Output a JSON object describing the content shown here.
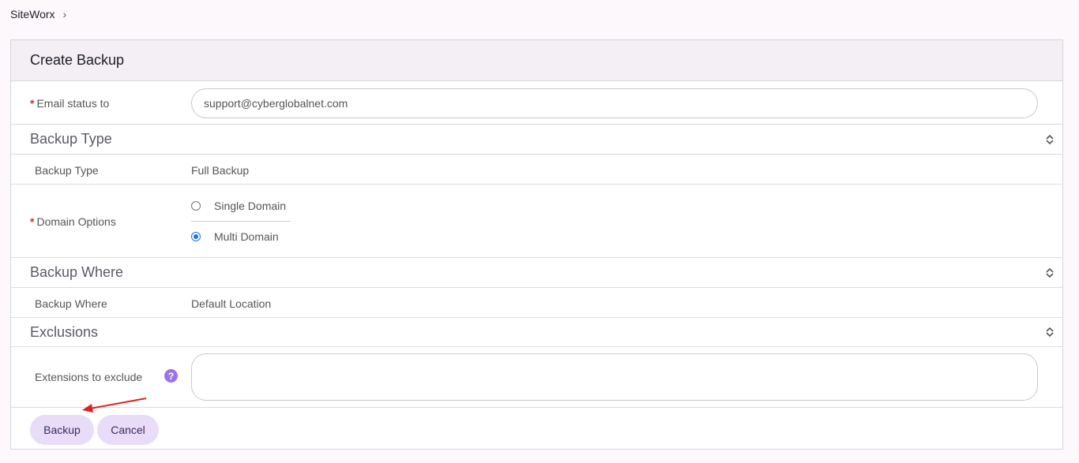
{
  "breadcrumb": {
    "root": "SiteWorx",
    "separator": "›"
  },
  "panel": {
    "title": "Create Backup"
  },
  "email": {
    "label": "Email status to",
    "required_mark": "*",
    "value": "support@cyberglobalnet.com"
  },
  "backup_type": {
    "section_title": "Backup Type",
    "label": "Backup Type",
    "value": "Full Backup"
  },
  "domain_options": {
    "label": "Domain Options",
    "required_mark": "*",
    "options": [
      {
        "label": "Single Domain",
        "checked": false
      },
      {
        "label": "Multi Domain",
        "checked": true
      }
    ]
  },
  "backup_where": {
    "section_title": "Backup Where",
    "label": "Backup Where",
    "value": "Default Location"
  },
  "exclusions": {
    "section_title": "Exclusions",
    "label": "Extensions to exclude",
    "help_symbol": "?",
    "value": ""
  },
  "actions": {
    "backup_label": "Backup",
    "cancel_label": "Cancel"
  },
  "colors": {
    "accent": "#1a73e8",
    "button_bg": "#e8dcf8",
    "help_icon": "#9a74e6",
    "required": "#c0392b",
    "annotation_arrow": "#e02020"
  },
  "icons": {
    "breadcrumb_separator": "chevron-right-icon",
    "section_toggle": "collapse-icon",
    "help": "help-icon",
    "annotation": "red-arrow-icon"
  }
}
